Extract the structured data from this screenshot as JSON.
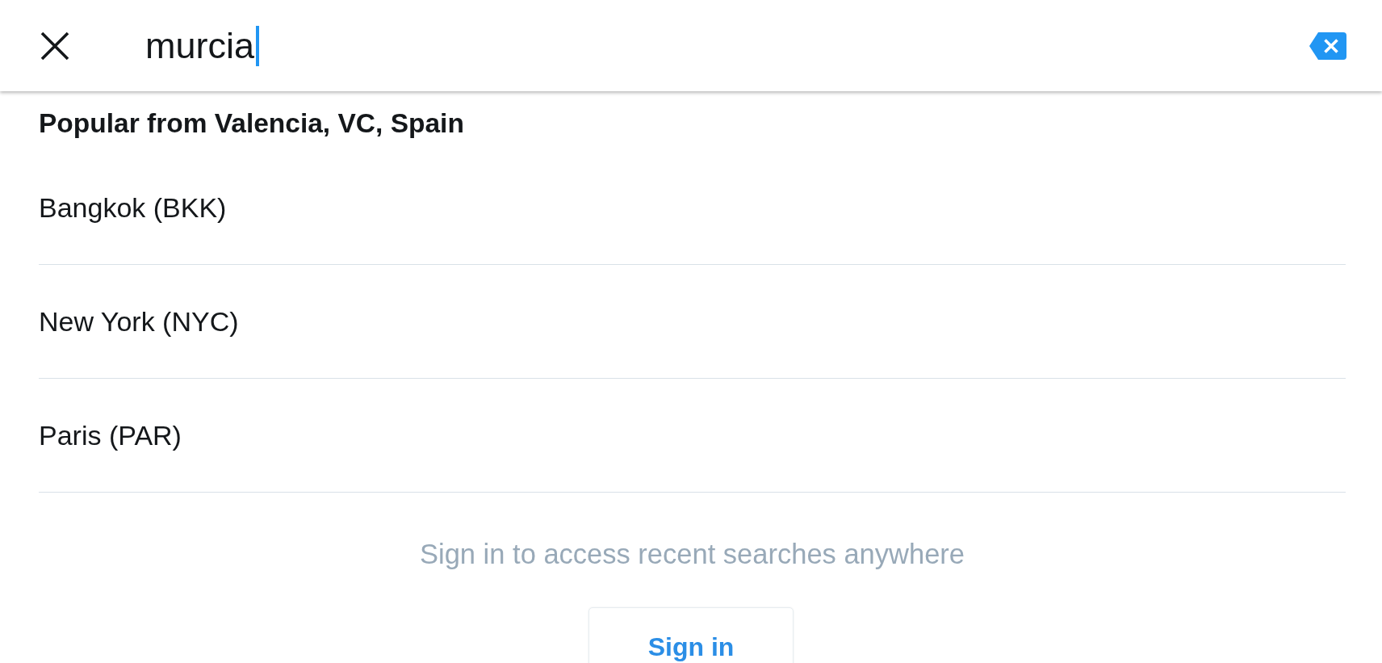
{
  "search": {
    "value": "murcia",
    "focused": true
  },
  "popular": {
    "heading": "Popular from Valencia, VC, Spain",
    "items": [
      {
        "label": "Bangkok (BKK)"
      },
      {
        "label": "New York (NYC)"
      },
      {
        "label": "Paris (PAR)"
      }
    ]
  },
  "sign_in_prompt": {
    "message": "Sign in to access recent searches anywhere",
    "button": "Sign in"
  }
}
